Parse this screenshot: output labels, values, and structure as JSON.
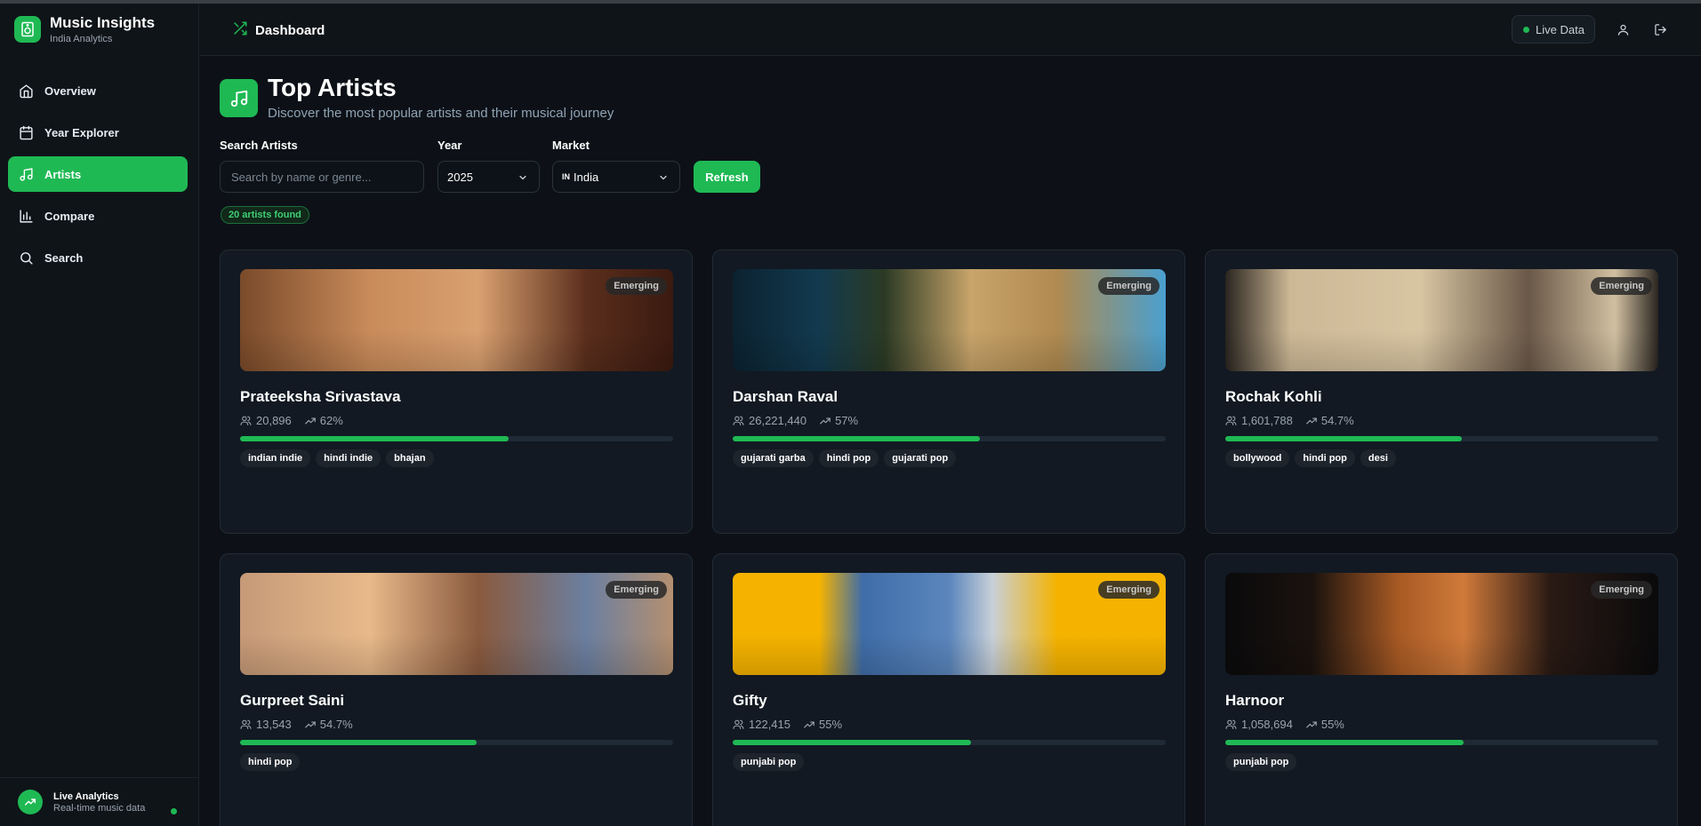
{
  "app": {
    "title": "Music Insights",
    "subtitle": "India Analytics"
  },
  "sidebar": {
    "items": [
      {
        "label": "Overview",
        "icon": "home-icon"
      },
      {
        "label": "Year Explorer",
        "icon": "calendar-icon"
      },
      {
        "label": "Artists",
        "icon": "music-note-icon",
        "active": true
      },
      {
        "label": "Compare",
        "icon": "bar-chart-icon"
      },
      {
        "label": "Search",
        "icon": "search-icon"
      }
    ],
    "footer": {
      "title": "Live Analytics",
      "subtitle": "Real-time music data"
    }
  },
  "header": {
    "title": "Dashboard",
    "live_label": "Live Data"
  },
  "page": {
    "title": "Top Artists",
    "subtitle": "Discover the most popular artists and their musical journey"
  },
  "filters": {
    "search_label": "Search Artists",
    "search_placeholder": "Search by name or genre...",
    "year_label": "Year",
    "year_value": "2025",
    "market_label": "Market",
    "market_flag": "IN",
    "market_value": "India",
    "refresh_label": "Refresh"
  },
  "results_count": "20 artists found",
  "colors": {
    "accent": "#1fb954",
    "background": "#0d1117",
    "card": "#121922"
  },
  "artists": [
    {
      "name": "Prateeksha Srivastava",
      "followers": "20,896",
      "popularity": "62%",
      "popularity_value": 62,
      "badge": "Emerging",
      "genres": [
        "indian indie",
        "hindi indie",
        "bhajan"
      ]
    },
    {
      "name": "Darshan Raval",
      "followers": "26,221,440",
      "popularity": "57%",
      "popularity_value": 57,
      "badge": "Emerging",
      "genres": [
        "gujarati garba",
        "hindi pop",
        "gujarati pop"
      ]
    },
    {
      "name": "Rochak Kohli",
      "followers": "1,601,788",
      "popularity": "54.7%",
      "popularity_value": 54.7,
      "badge": "Emerging",
      "genres": [
        "bollywood",
        "hindi pop",
        "desi"
      ]
    },
    {
      "name": "Gurpreet Saini",
      "followers": "13,543",
      "popularity": "54.7%",
      "popularity_value": 54.7,
      "badge": "Emerging",
      "genres": [
        "hindi pop"
      ]
    },
    {
      "name": "Gifty",
      "followers": "122,415",
      "popularity": "55%",
      "popularity_value": 55,
      "badge": "Emerging",
      "genres": [
        "punjabi pop"
      ]
    },
    {
      "name": "Harnoor",
      "followers": "1,058,694",
      "popularity": "55%",
      "popularity_value": 55,
      "badge": "Emerging",
      "genres": [
        "punjabi pop"
      ]
    }
  ]
}
